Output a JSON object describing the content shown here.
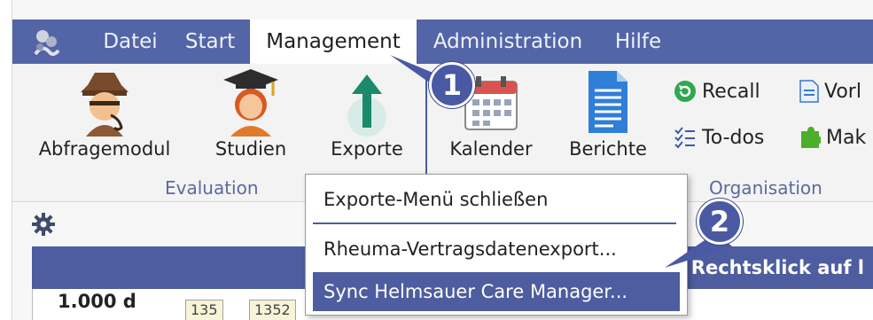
{
  "tabs": {
    "datei": "Datei",
    "start": "Start",
    "management": "Management",
    "administration": "Administration",
    "hilfe": "Hilfe"
  },
  "ribbon": {
    "abfragemodul": "Abfragemodul",
    "studien": "Studien",
    "exporte": "Exporte",
    "kalender": "Kalender",
    "berichte": "Berichte",
    "recall": "Recall",
    "todos": "To-dos",
    "vorl_partial": "Vorl",
    "mak_partial": "Mak",
    "group_evaluation": "Evaluation",
    "group_organisation": "Organisation"
  },
  "menu": {
    "close": "Exporte-Menü schließen",
    "rheuma": "Rheuma-Vertragsdatenexport...",
    "sync": "Sync Helmsauer Care Manager..."
  },
  "lower": {
    "band_text": "→ Rechtsklick auf l",
    "row_label": "1.000 d",
    "box1": "135",
    "box2": "1352"
  },
  "callouts": {
    "one": "1",
    "two": "2"
  },
  "colors": {
    "tabbar": "#5365a7",
    "accent": "#4e5d9f",
    "callout": "#4a59a3"
  }
}
